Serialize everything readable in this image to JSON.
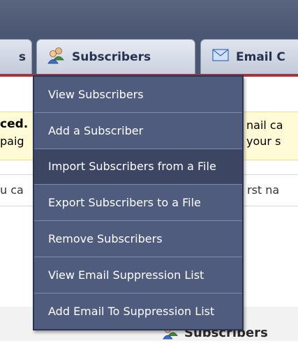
{
  "tabs": {
    "left_partial": "s",
    "subscribers": "Subscribers",
    "email_partial": "Email C"
  },
  "menu": {
    "items": [
      {
        "label": "View Subscribers"
      },
      {
        "label": "Add a Subscriber"
      },
      {
        "label": "Import Subscribers from a File"
      },
      {
        "label": "Export Subscribers to a File"
      },
      {
        "label": "Remove Subscribers"
      },
      {
        "label": "View Email Suppression List"
      },
      {
        "label": "Add Email To Suppression List"
      }
    ],
    "hovered_index": 2
  },
  "notice": {
    "left_line1": "ced.",
    "left_line2": "paig",
    "right_line1": "nail ca",
    "right_line2": "your s"
  },
  "info": {
    "left": "u ca",
    "right": "rst na"
  },
  "section": {
    "heading": "Subscribers"
  },
  "colors": {
    "header_bg": "#4b5672",
    "menu_bg": "#4f5c7e",
    "menu_hover": "#3c4663",
    "accent_red": "#c8252a",
    "notice_bg": "#fffbd6"
  }
}
